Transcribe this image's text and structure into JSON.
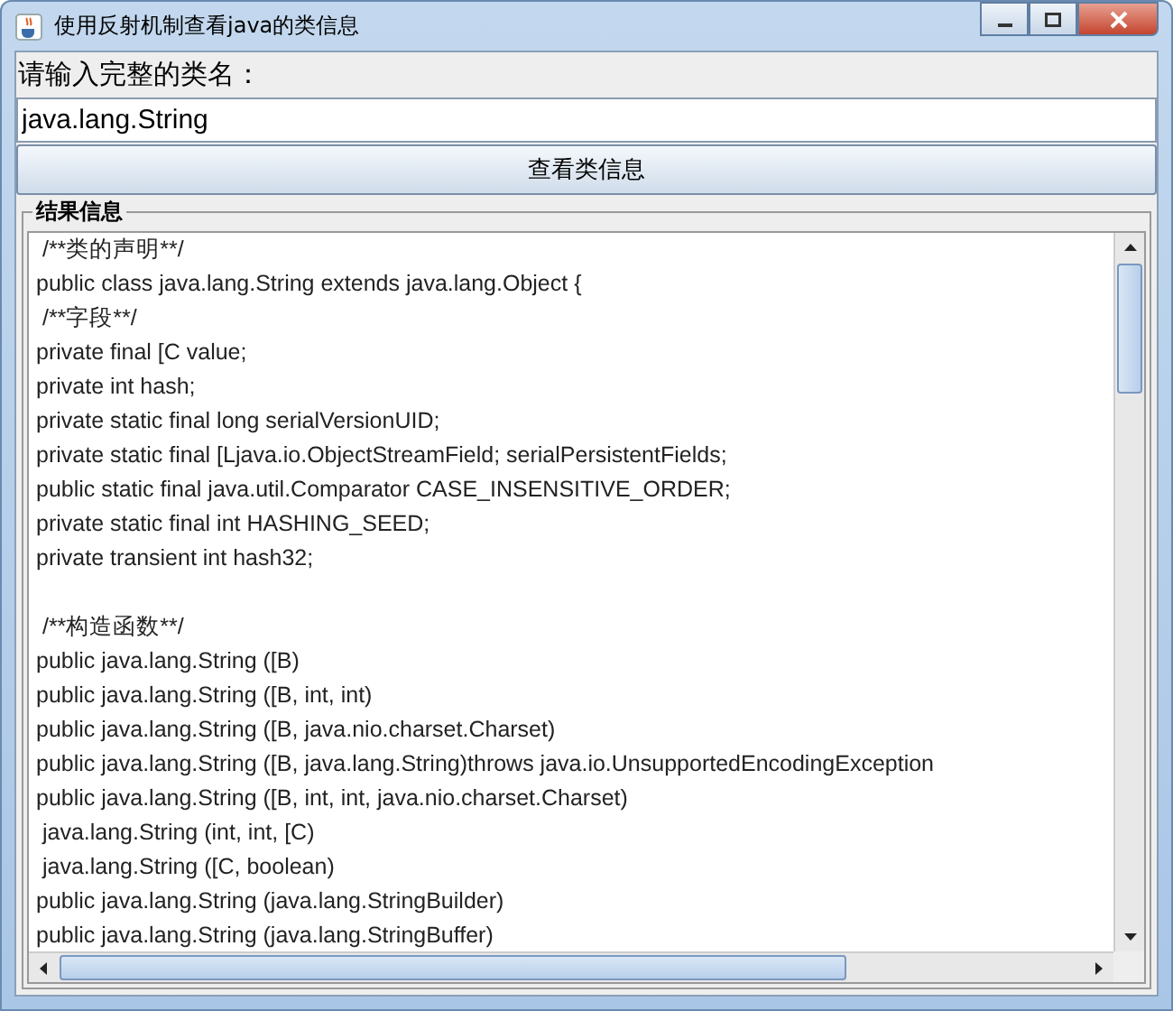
{
  "window": {
    "title": "使用反射机制查看java的类信息"
  },
  "prompt": "请输入完整的类名：",
  "class_field": {
    "value": "java.lang.String"
  },
  "button": "查看类信息",
  "result": {
    "title": "结果信息",
    "blocks": [
      [
        " /**类的声明**/",
        "public class java.lang.String extends java.lang.Object {",
        " /**字段**/",
        "private final [C value;",
        "private int hash;",
        "private static final long serialVersionUID;",
        "private static final [Ljava.io.ObjectStreamField; serialPersistentFields;",
        "public static final java.util.Comparator CASE_INSENSITIVE_ORDER;",
        "private static final int HASHING_SEED;",
        "private transient int hash32;"
      ],
      [
        " /**构造函数**/",
        "public java.lang.String ([B)",
        "public java.lang.String ([B, int, int)",
        "public java.lang.String ([B, java.nio.charset.Charset)",
        "public java.lang.String ([B, java.lang.String)throws java.io.UnsupportedEncodingException",
        "public java.lang.String ([B, int, int, java.nio.charset.Charset)",
        " java.lang.String (int, int, [C)",
        " java.lang.String ([C, boolean)",
        "public java.lang.String (java.lang.StringBuilder)",
        "public java.lang.String (java.lang.StringBuffer)"
      ]
    ]
  }
}
